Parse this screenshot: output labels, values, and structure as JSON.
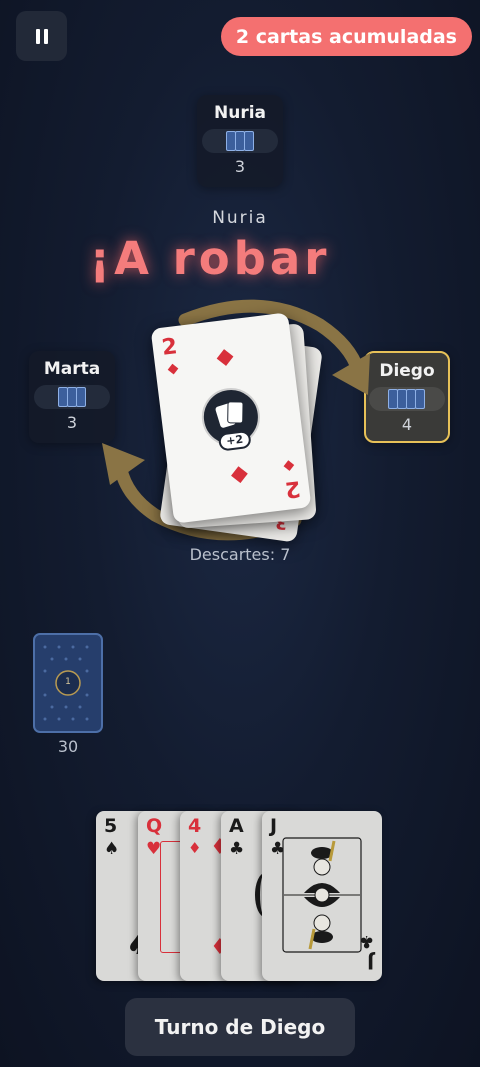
{
  "hud": {
    "stack_badge": "2 cartas acumuladas"
  },
  "players": {
    "top": {
      "name": "Nuria",
      "count": "3"
    },
    "left": {
      "name": "Marta",
      "count": "3"
    },
    "right": {
      "name": "Diego",
      "count": "4"
    }
  },
  "banner": {
    "player": "Nuria",
    "message": "¡A robar"
  },
  "discard": {
    "top_card": {
      "rank": "2",
      "suit": "diamonds",
      "effect": "+2",
      "color": "#d8303b"
    },
    "under_card_rank": "3",
    "label": "Descartes: 7"
  },
  "deck": {
    "chip": "1",
    "count": "30"
  },
  "hand": [
    {
      "rank": "5",
      "suit": "spades",
      "symbol": "♠",
      "color": "#1a1a1a"
    },
    {
      "rank": "Q",
      "suit": "hearts",
      "symbol": "♥",
      "color": "#d8303b"
    },
    {
      "rank": "4",
      "suit": "diamonds",
      "symbol": "♦",
      "color": "#d8303b"
    },
    {
      "rank": "A",
      "suit": "clubs",
      "symbol": "♣",
      "color": "#1a1a1a"
    },
    {
      "rank": "J",
      "suit": "clubs",
      "symbol": "♣",
      "color": "#1a1a1a"
    }
  ],
  "turn": {
    "label": "Turno de Diego"
  },
  "colors": {
    "accent_red": "#f47070",
    "active_border": "#e7c158",
    "arrow": "#8a7445"
  }
}
